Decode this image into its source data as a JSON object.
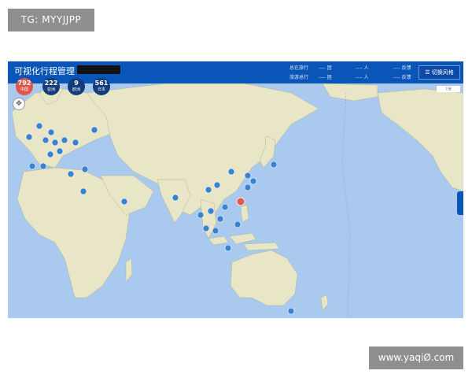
{
  "watermarks": {
    "top": "TG: MYYJJPP",
    "bottom": "www.yaqiØ.com"
  },
  "header": {
    "title": "可视化行程管理",
    "stats": [
      {
        "label": "总在旅行",
        "value": "---- 团"
      },
      {
        "label": "旅游总行",
        "value": "---- 团"
      },
      {
        "label": "",
        "value": "---- 人"
      },
      {
        "label": "",
        "value": "---- 人"
      },
      {
        "label": "",
        "value": "---- 反馈"
      },
      {
        "label": "",
        "value": "---- 反馈"
      }
    ],
    "switch_button": "切换风格"
  },
  "summary": [
    {
      "number": "792",
      "label": "中国",
      "color": "#e0554c"
    },
    {
      "number": "222",
      "label": "亚洲",
      "color": "#123d7a"
    },
    {
      "number": "9",
      "label": "欧洲",
      "color": "#123d7a"
    },
    {
      "number": "561",
      "label": "日本",
      "color": "#123d7a"
    }
  ],
  "map": {
    "ocean_color": "#a9c9ef",
    "land_color": "#e8e6c7",
    "pin_color": "#3a82d0",
    "pin_active_color": "#e45a52",
    "badge": "卫星"
  }
}
